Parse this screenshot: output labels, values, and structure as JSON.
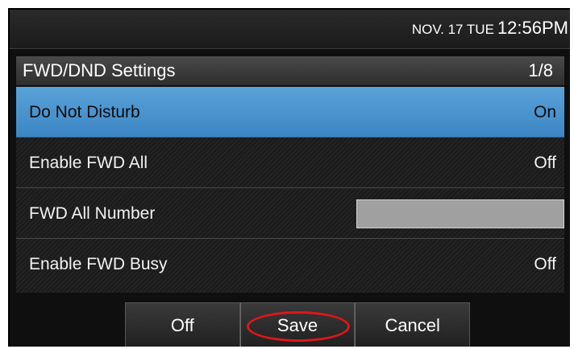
{
  "status": {
    "date": "NOV. 17 TUE",
    "time": "12:56PM"
  },
  "header": {
    "title": "FWD/DND Settings",
    "page": "1/8"
  },
  "settings": [
    {
      "label": "Do Not Disturb",
      "value": "On",
      "selected": true
    },
    {
      "label": "Enable FWD All",
      "value": "Off"
    },
    {
      "label": "FWD All Number",
      "value": ""
    },
    {
      "label": "Enable FWD Busy",
      "value": "Off"
    }
  ],
  "softkeys": {
    "off": "Off",
    "save": "Save",
    "cancel": "Cancel"
  },
  "colors": {
    "selection": "#4a94cf",
    "annotation_ring": "#e0161b"
  }
}
